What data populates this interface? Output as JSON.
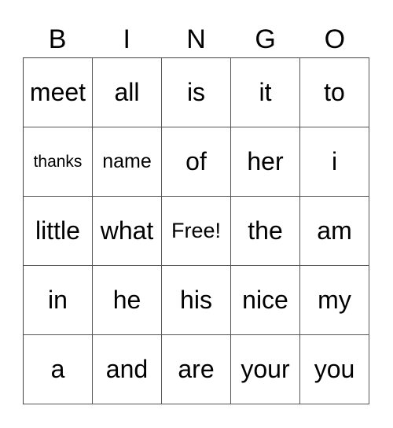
{
  "header": {
    "letters": [
      "B",
      "I",
      "N",
      "G",
      "O"
    ]
  },
  "card": {
    "rows": [
      [
        "meet",
        "all",
        "is",
        "it",
        "to"
      ],
      [
        "thanks",
        "name",
        "of",
        "her",
        "i"
      ],
      [
        "little",
        "what",
        "Free!",
        "the",
        "am"
      ],
      [
        "in",
        "he",
        "his",
        "nice",
        "my"
      ],
      [
        "a",
        "and",
        "are",
        "your",
        "you"
      ]
    ]
  }
}
